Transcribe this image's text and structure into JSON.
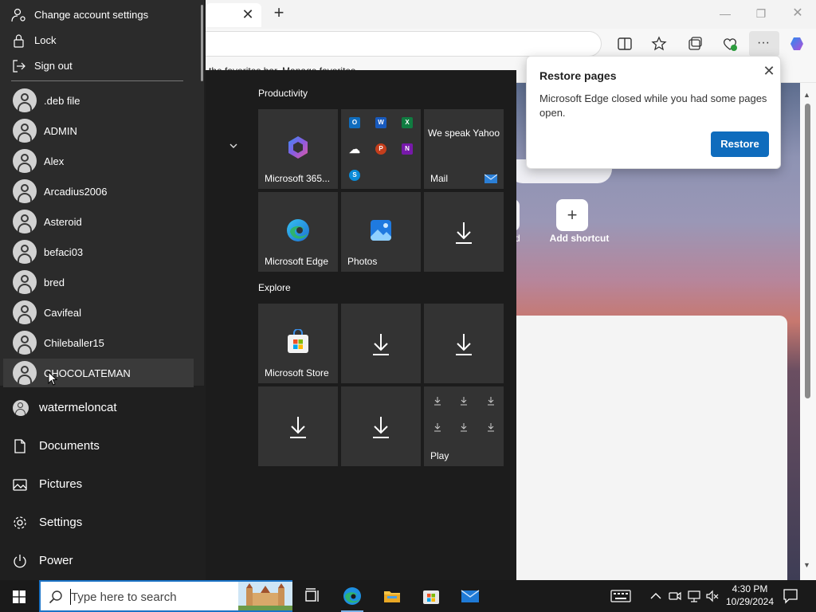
{
  "edge": {
    "favbar_text": "the favorites bar. Manage favorites",
    "add_shortcut_label": "Add shortcut",
    "ghost_label": "d"
  },
  "restore_popup": {
    "title": "Restore pages",
    "message": "Microsoft Edge closed while you had some pages open.",
    "button": "Restore",
    "accent": "#0f6cbd"
  },
  "account_menu": {
    "items": [
      {
        "label": "Change account settings",
        "icon": "person-settings-icon"
      },
      {
        "label": "Lock",
        "icon": "lock-icon"
      },
      {
        "label": "Sign out",
        "icon": "sign-out-icon"
      }
    ],
    "users": [
      ".deb file",
      "ADMIN",
      "Alex",
      "Arcadius2006",
      "Asteroid",
      "befaci03",
      "bred",
      "Cavifeal",
      "Chileballer15",
      "CHOCOLATEMAN"
    ]
  },
  "start_nav": {
    "current_user": "watermeloncat",
    "items": [
      {
        "label": "Documents",
        "icon": "document-icon"
      },
      {
        "label": "Pictures",
        "icon": "pictures-icon"
      },
      {
        "label": "Settings",
        "icon": "gear-icon"
      },
      {
        "label": "Power",
        "icon": "power-icon"
      }
    ]
  },
  "tiles": {
    "groups": [
      "Productivity",
      "Explore"
    ],
    "microsoft365": "Microsoft 365...",
    "mail_promo": "We speak Yahoo",
    "mail": "Mail",
    "edge": "Microsoft Edge",
    "photos": "Photos",
    "store": "Microsoft Store",
    "play": "Play"
  },
  "taskbar": {
    "search_placeholder": "Type here to search",
    "time": "4:30 PM",
    "date": "10/29/2024"
  }
}
